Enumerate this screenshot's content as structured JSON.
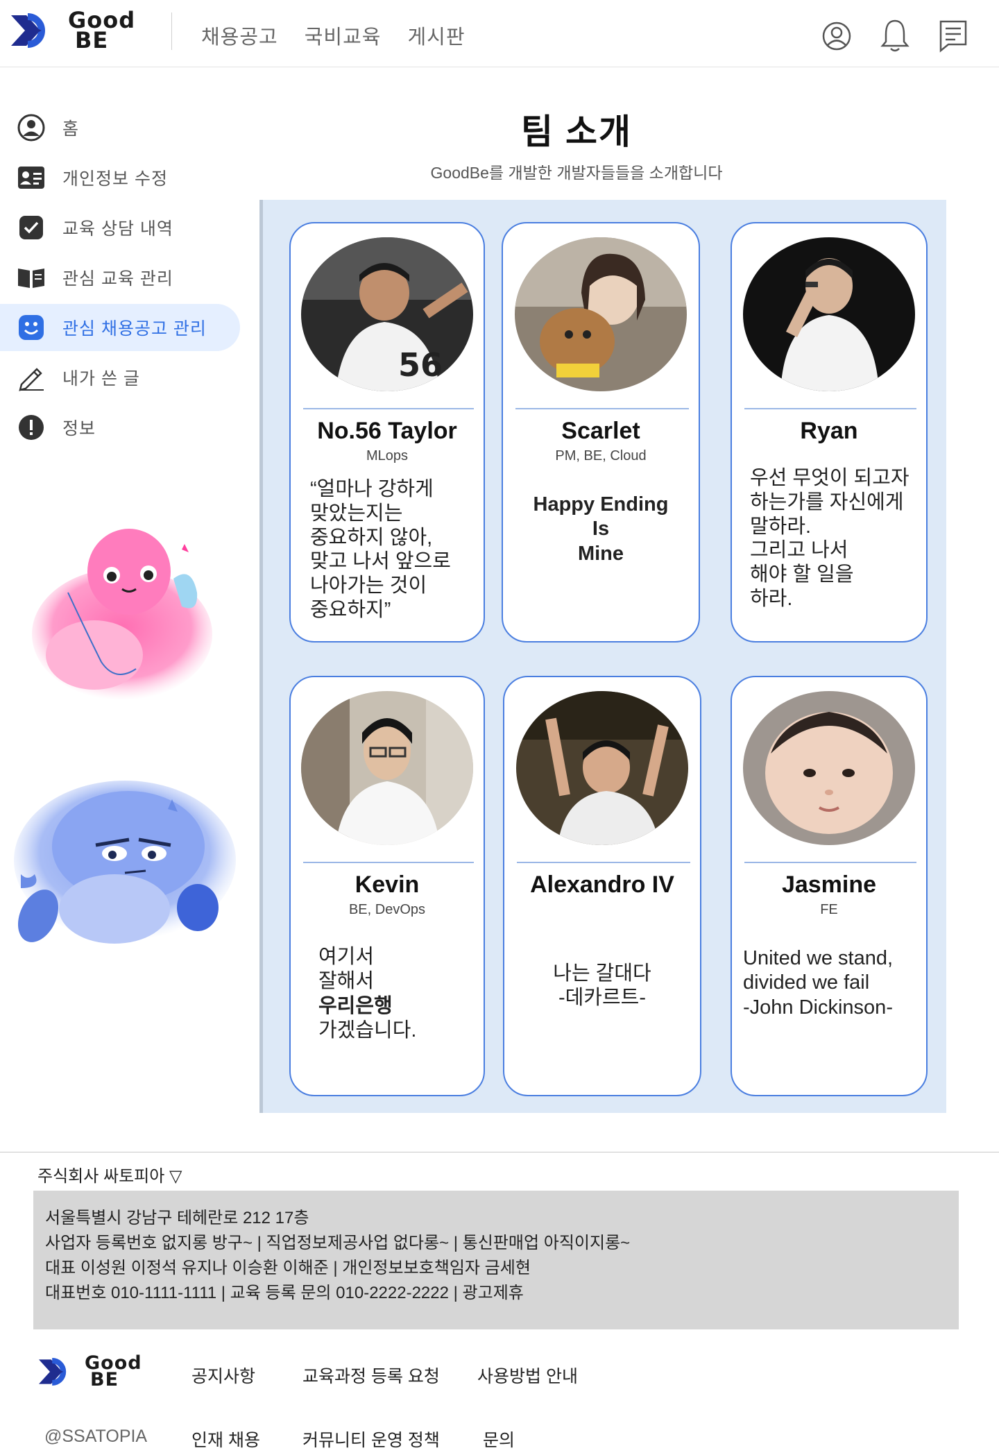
{
  "header": {
    "logo": {
      "line1": "Good",
      "line2": "BE"
    },
    "nav": [
      "채용공고",
      "국비교육",
      "게시판"
    ],
    "icons": [
      "user-circle-icon",
      "bell-icon",
      "message-icon"
    ]
  },
  "sidebar": {
    "items": [
      {
        "label": "홈",
        "icon": "user-circle-icon",
        "active": false
      },
      {
        "label": "개인정보 수정",
        "icon": "id-card-icon",
        "active": false
      },
      {
        "label": "교육 상담 내역",
        "icon": "check-box-icon",
        "active": false
      },
      {
        "label": "관심 교육 관리",
        "icon": "book-icon",
        "active": false
      },
      {
        "label": "관심 채용공고 관리",
        "icon": "smile-icon",
        "active": true
      },
      {
        "label": "내가 쓴 글",
        "icon": "pencil-icon",
        "active": false
      },
      {
        "label": "정보",
        "icon": "info-icon",
        "active": false
      }
    ],
    "accent_color": "#2f6fe4"
  },
  "main": {
    "title": "팀 소개",
    "subtitle": "GoodBe를 개발한 개발자들들을 소개합니다",
    "members": [
      {
        "name": "No.56 Taylor",
        "role": "MLops",
        "quote": [
          "“얼마나 강하게",
          "맞았는지는",
          "중요하지 않아,",
          "맞고 나서 앞으로",
          "나아가는 것이",
          "중요하지”"
        ]
      },
      {
        "name": "Scarlet",
        "role": "PM, BE, Cloud",
        "quote": [
          "Happy Ending",
          "Is",
          "Mine"
        ]
      },
      {
        "name": "Ryan",
        "role": "",
        "quote": [
          "우선 무엇이 되고자",
          "하는가를 자신에게",
          "말하라.",
          "그리고 나서",
          "해야 할 일을",
          "하라."
        ]
      },
      {
        "name": "Kevin",
        "role": "BE, DevOps",
        "quote": [
          "여기서",
          "잘해서",
          "우리은행",
          "가겠습니다."
        ]
      },
      {
        "name": "Alexandro IV",
        "role": "",
        "quote": [
          "나는 갈대다",
          "-데카르트-"
        ]
      },
      {
        "name": "Jasmine",
        "role": "FE",
        "quote": [
          "United we stand,",
          "divided we fail",
          "-John Dickinson-"
        ]
      }
    ]
  },
  "footer": {
    "company": "주식회사 싸토피아 ▽",
    "info": [
      "서울특별시 강남구 테헤란로 212 17층",
      "사업자 등록번호  없지롱 방구~ | 직업정보제공사업 없다롱~ | 통신판매업 아직이지롱~",
      "대표 이성원 이정석 유지나 이승환 이해준 | 개인정보보호책임자 금세현",
      "대표번호 010-1111-1111 | 교육 등록 문의 010-2222-2222 | 광고제휴"
    ],
    "logo": {
      "line1": "Good",
      "line2": "BE"
    },
    "links_row1": [
      "공지사항",
      "교육과정 등록 요청",
      "사용방법 안내"
    ],
    "handle": "@SSATOPIA",
    "links_row2": [
      "인재 채용",
      "커뮤니티 운영 정책",
      "문의"
    ]
  }
}
